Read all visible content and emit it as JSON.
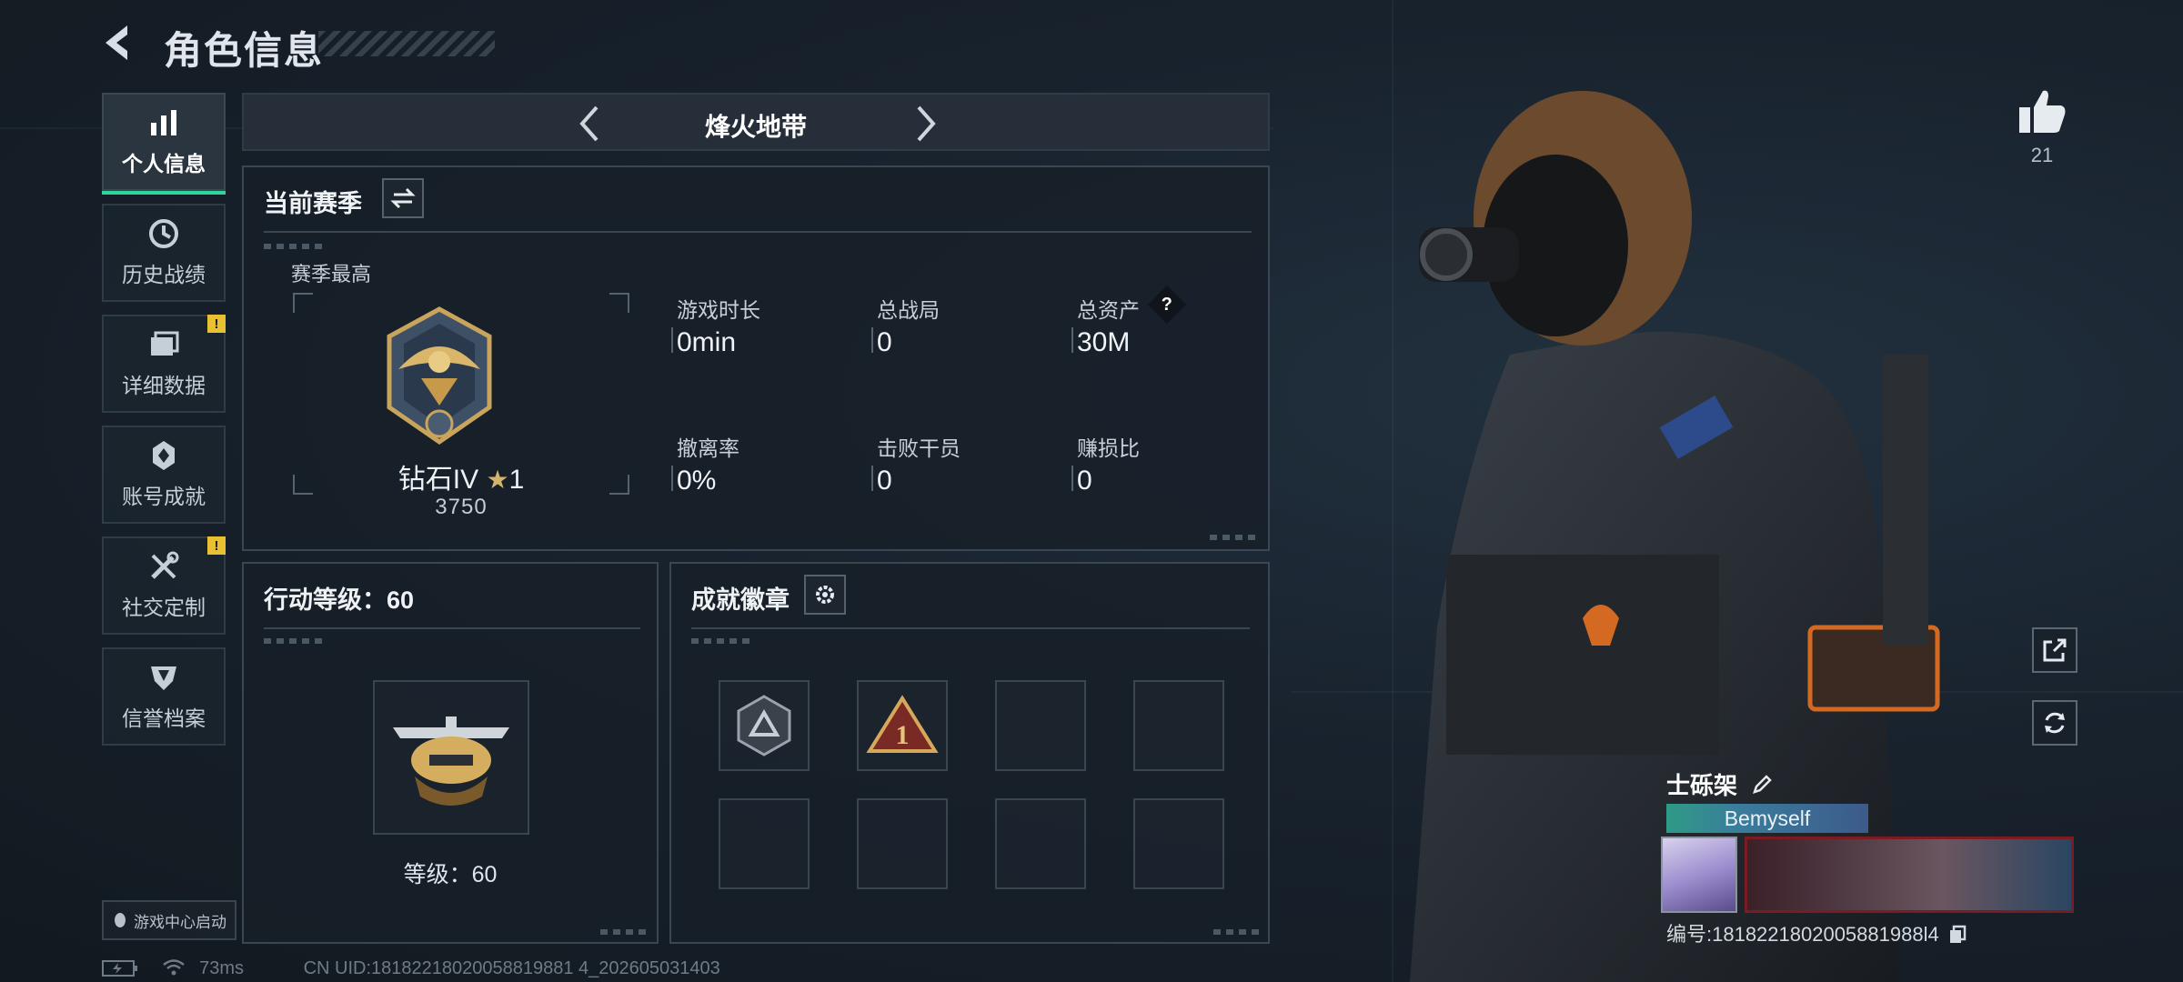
{
  "header": {
    "title": "角色信息"
  },
  "sidebar": {
    "items": [
      {
        "label": "个人信息",
        "icon": "bar-chart-icon",
        "active": true
      },
      {
        "label": "历史战绩",
        "icon": "clock-history-icon",
        "active": false
      },
      {
        "label": "详细数据",
        "icon": "folder-icon",
        "active": false,
        "alert": "!"
      },
      {
        "label": "账号成就",
        "icon": "achievement-icon",
        "active": false
      },
      {
        "label": "社交定制",
        "icon": "tools-icon",
        "active": false,
        "alert": "!"
      },
      {
        "label": "信誉档案",
        "icon": "credit-shield-icon",
        "active": false
      }
    ],
    "launch": "游戏中心启动"
  },
  "mode_selector": {
    "name": "烽火地带"
  },
  "season": {
    "title": "当前赛季",
    "best_label": "赛季最高",
    "rank": "钻石IV",
    "stars": "1",
    "score": "3750",
    "stats": [
      {
        "label": "游戏时长",
        "value": "0min"
      },
      {
        "label": "总战局",
        "value": "0"
      },
      {
        "label": "总资产",
        "value": "30M"
      },
      {
        "label": "撤离率",
        "value": "0%"
      },
      {
        "label": "击败干员",
        "value": "0"
      },
      {
        "label": "赚损比",
        "value": "0"
      }
    ],
    "help": "?"
  },
  "action_level": {
    "title": "行动等级：60",
    "level_text": "等级：60"
  },
  "badges": {
    "title": "成就徽章"
  },
  "likes": {
    "count": "21"
  },
  "player": {
    "name": "士砾架",
    "nameplate": "Bemyself",
    "id_text": "编号:1818221802005881988l4"
  },
  "status": {
    "ping": "73ms",
    "uid": "CN UID:18182218020058819881 4_202605031403"
  },
  "colors": {
    "accent": "#2fd699",
    "alert": "#e8c032",
    "background": "#18222d"
  }
}
